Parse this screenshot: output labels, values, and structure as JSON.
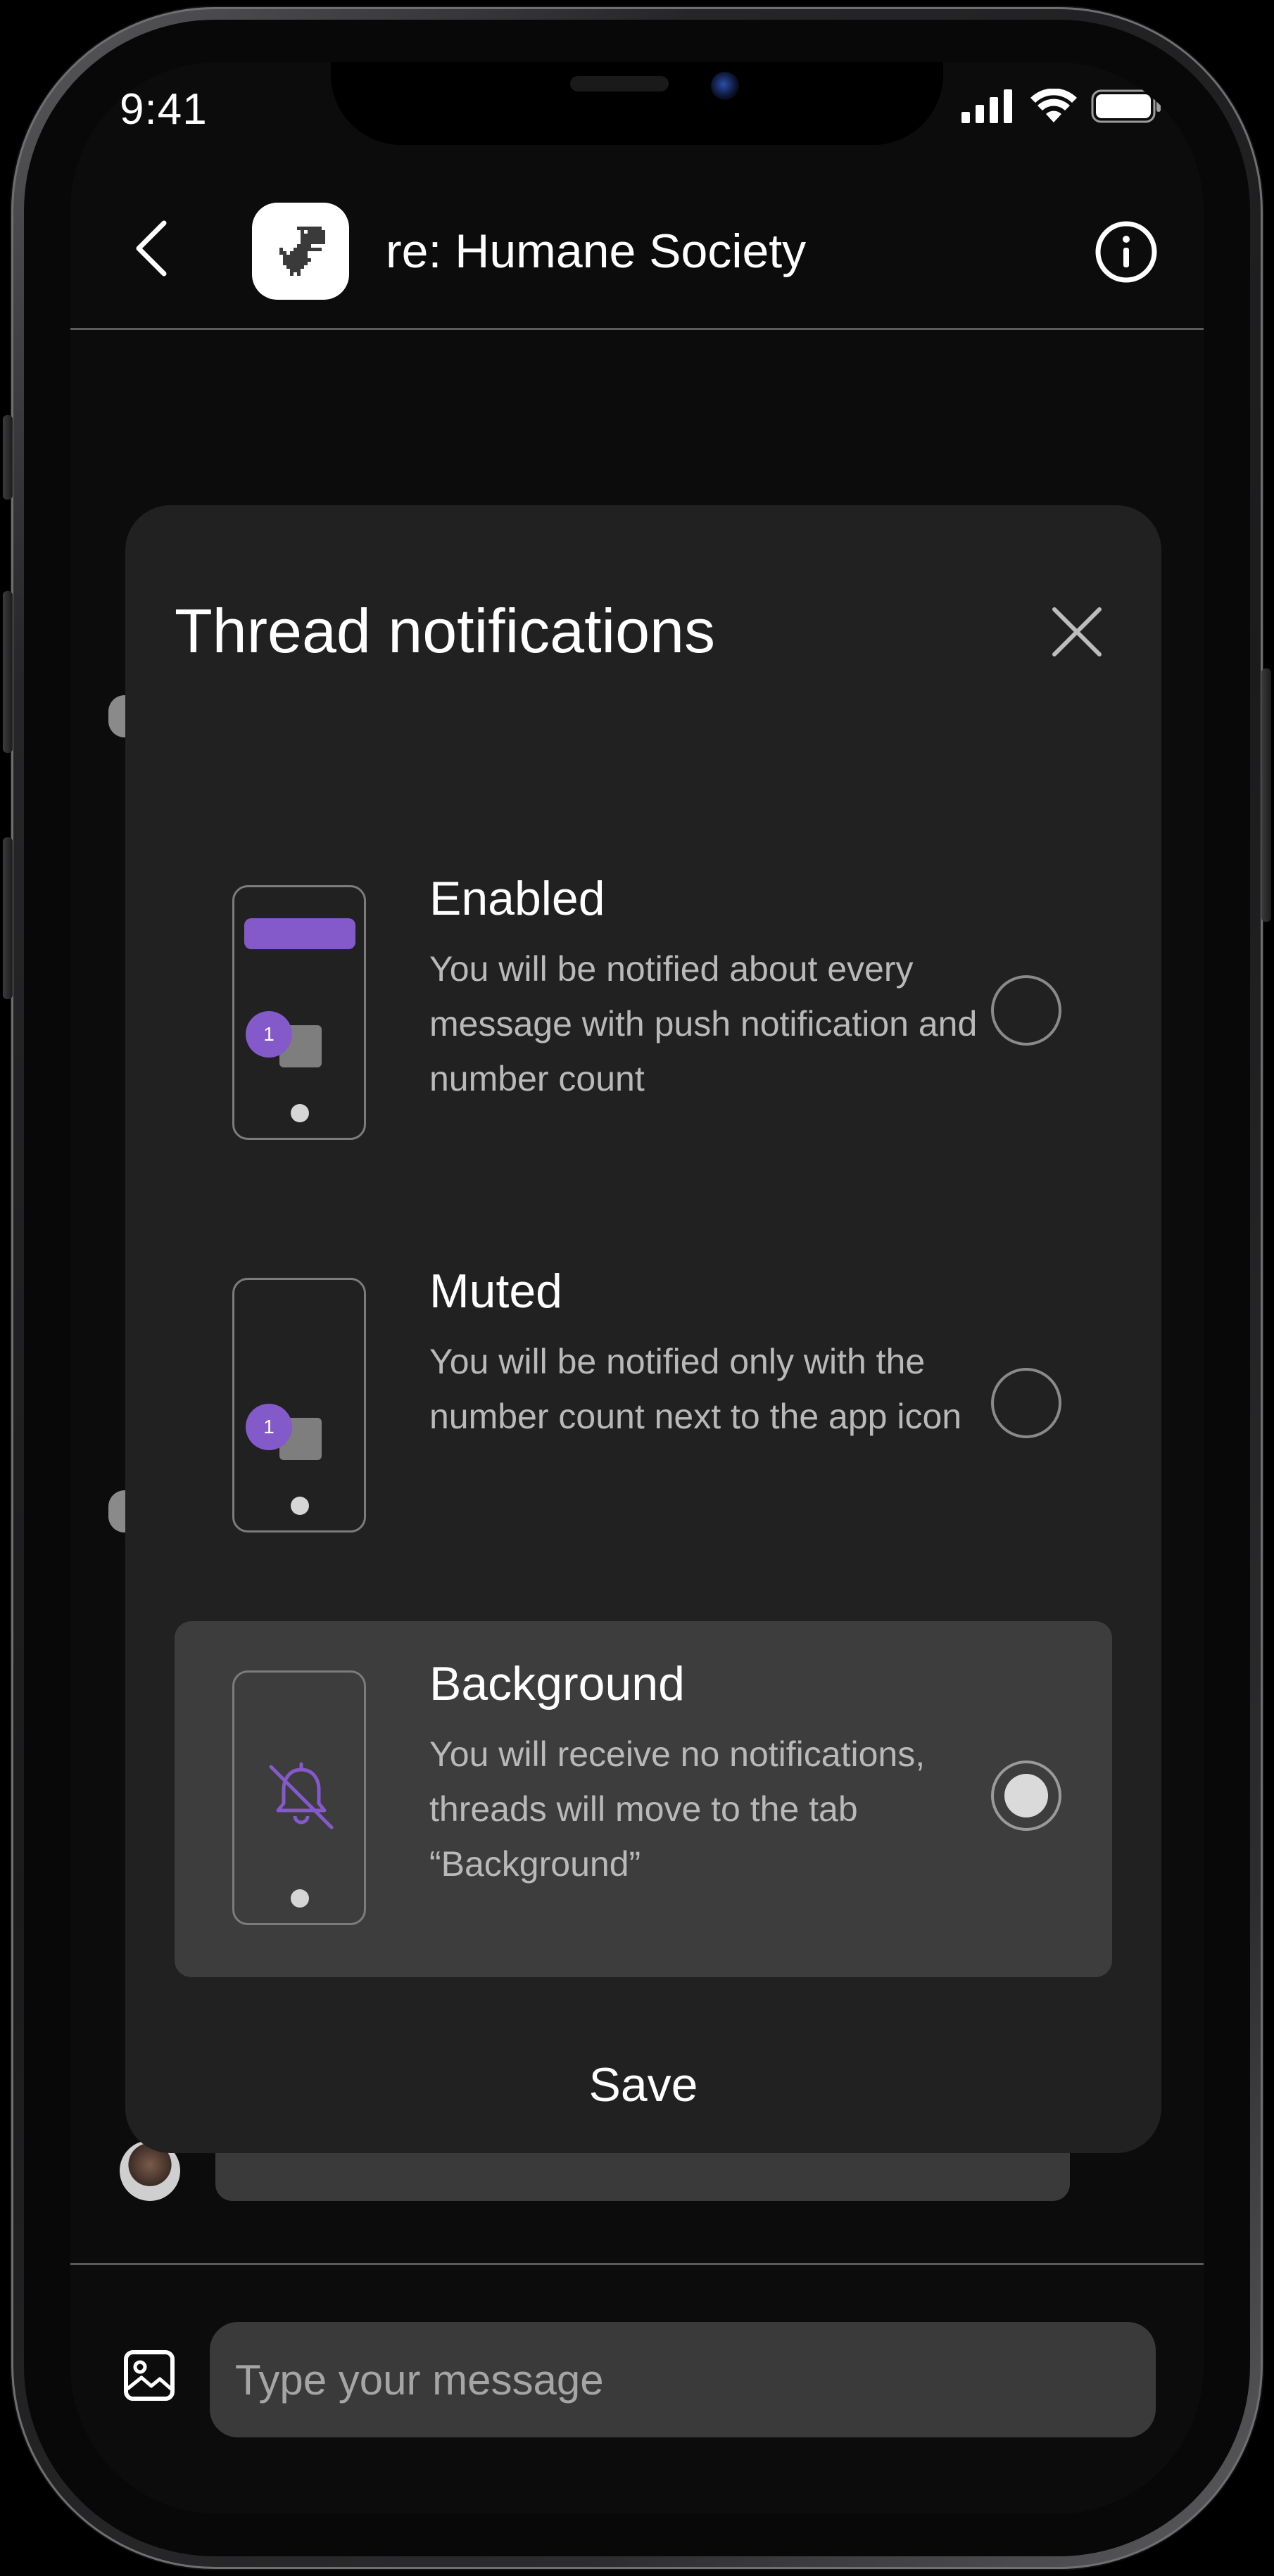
{
  "status_bar": {
    "time": "9:41"
  },
  "header": {
    "title": "re: Humane Society",
    "icons": {
      "back": "chevron-left-icon",
      "avatar": "dino-icon",
      "info": "info-icon"
    }
  },
  "modal": {
    "title": "Thread notifications",
    "options": [
      {
        "title": "Enabled",
        "description": "You will be notified about every message with push notification and number count",
        "badge": "1",
        "selected": false
      },
      {
        "title": "Muted",
        "description": "You will be notified only with the number count next to the app icon",
        "badge": "1",
        "selected": false
      },
      {
        "title": "Background",
        "description": "You will receive no notifications, threads will move to the tab “Background”",
        "selected": true
      }
    ],
    "save_label": "Save"
  },
  "composer": {
    "placeholder": "Type your message"
  },
  "colors": {
    "accent": "#8459c9",
    "modal_bg": "#212121",
    "selected_bg": "#3d3d3d",
    "screen_bg": "#0c0c0c"
  }
}
